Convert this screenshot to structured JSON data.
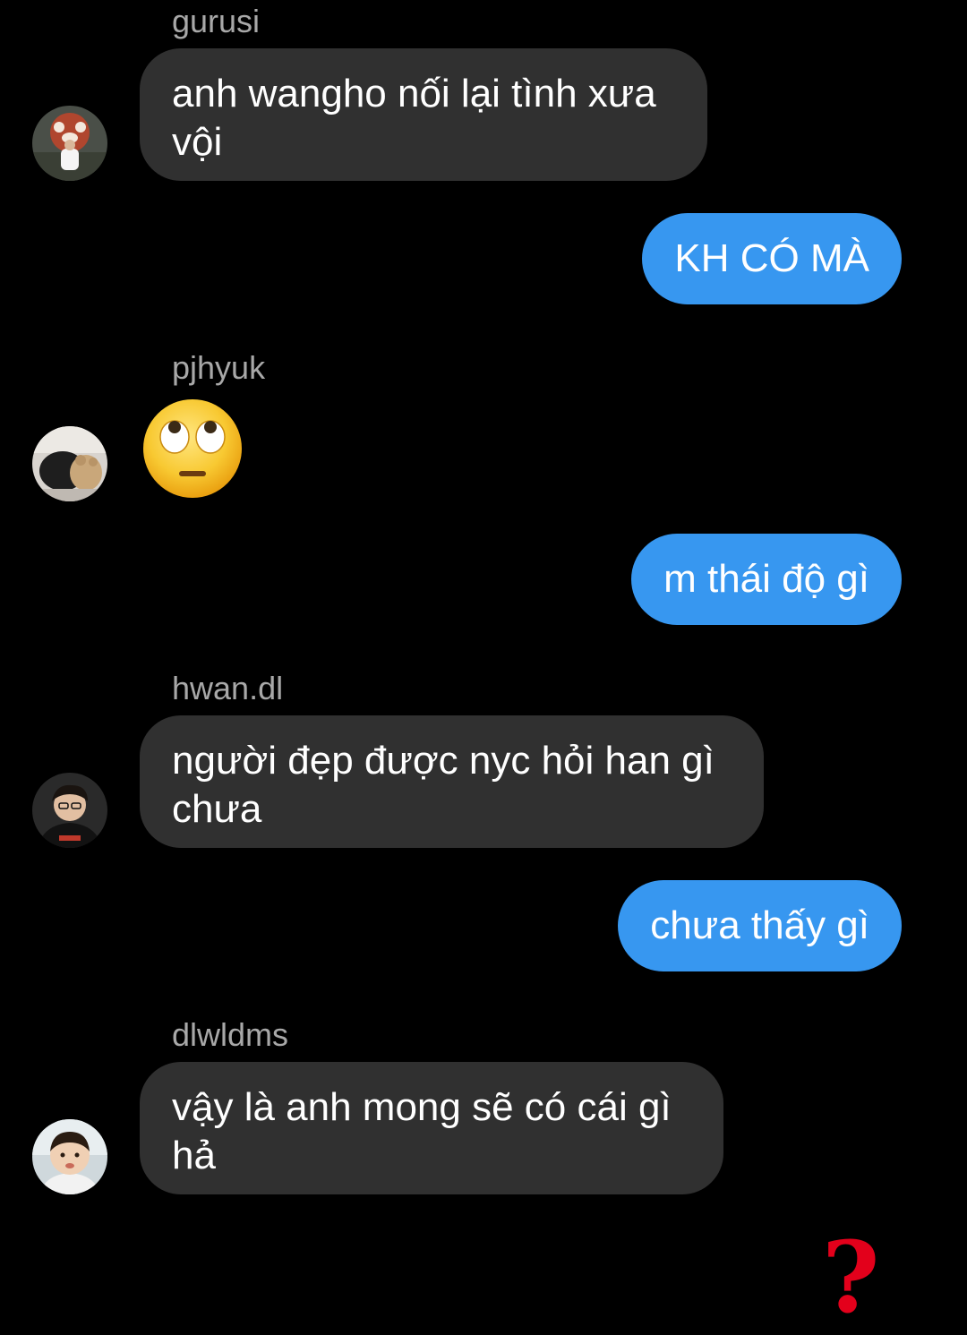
{
  "colors": {
    "background": "#000000",
    "incoming_bubble": "#303030",
    "outgoing_bubble": "#3797f0",
    "sender_name": "#a8a8a8",
    "reaction_mark": "#e3001b"
  },
  "messages": [
    {
      "direction": "incoming",
      "sender": "gurusi",
      "avatar": "avatar-red-panda-photo",
      "text": "anh wangho nối lại tình xưa vội"
    },
    {
      "direction": "outgoing",
      "text": "KH CÓ MÀ"
    },
    {
      "direction": "incoming",
      "sender": "pjhyuk",
      "avatar": "avatar-plush-toy-photo",
      "emoji": "face-with-rolling-eyes",
      "text": "🙄"
    },
    {
      "direction": "outgoing",
      "text": "m thái độ gì"
    },
    {
      "direction": "incoming",
      "sender": "hwan.dl",
      "avatar": "avatar-person-photo",
      "text": "người đẹp được nyc hỏi han gì chưa"
    },
    {
      "direction": "outgoing",
      "text": "chưa thấy gì"
    },
    {
      "direction": "incoming",
      "sender": "dlwldms",
      "avatar": "avatar-child-photo",
      "text": "vậy là anh mong sẽ có cái gì hả"
    }
  ],
  "overlay": {
    "mark": "?",
    "icon": "red-question-mark-icon"
  }
}
